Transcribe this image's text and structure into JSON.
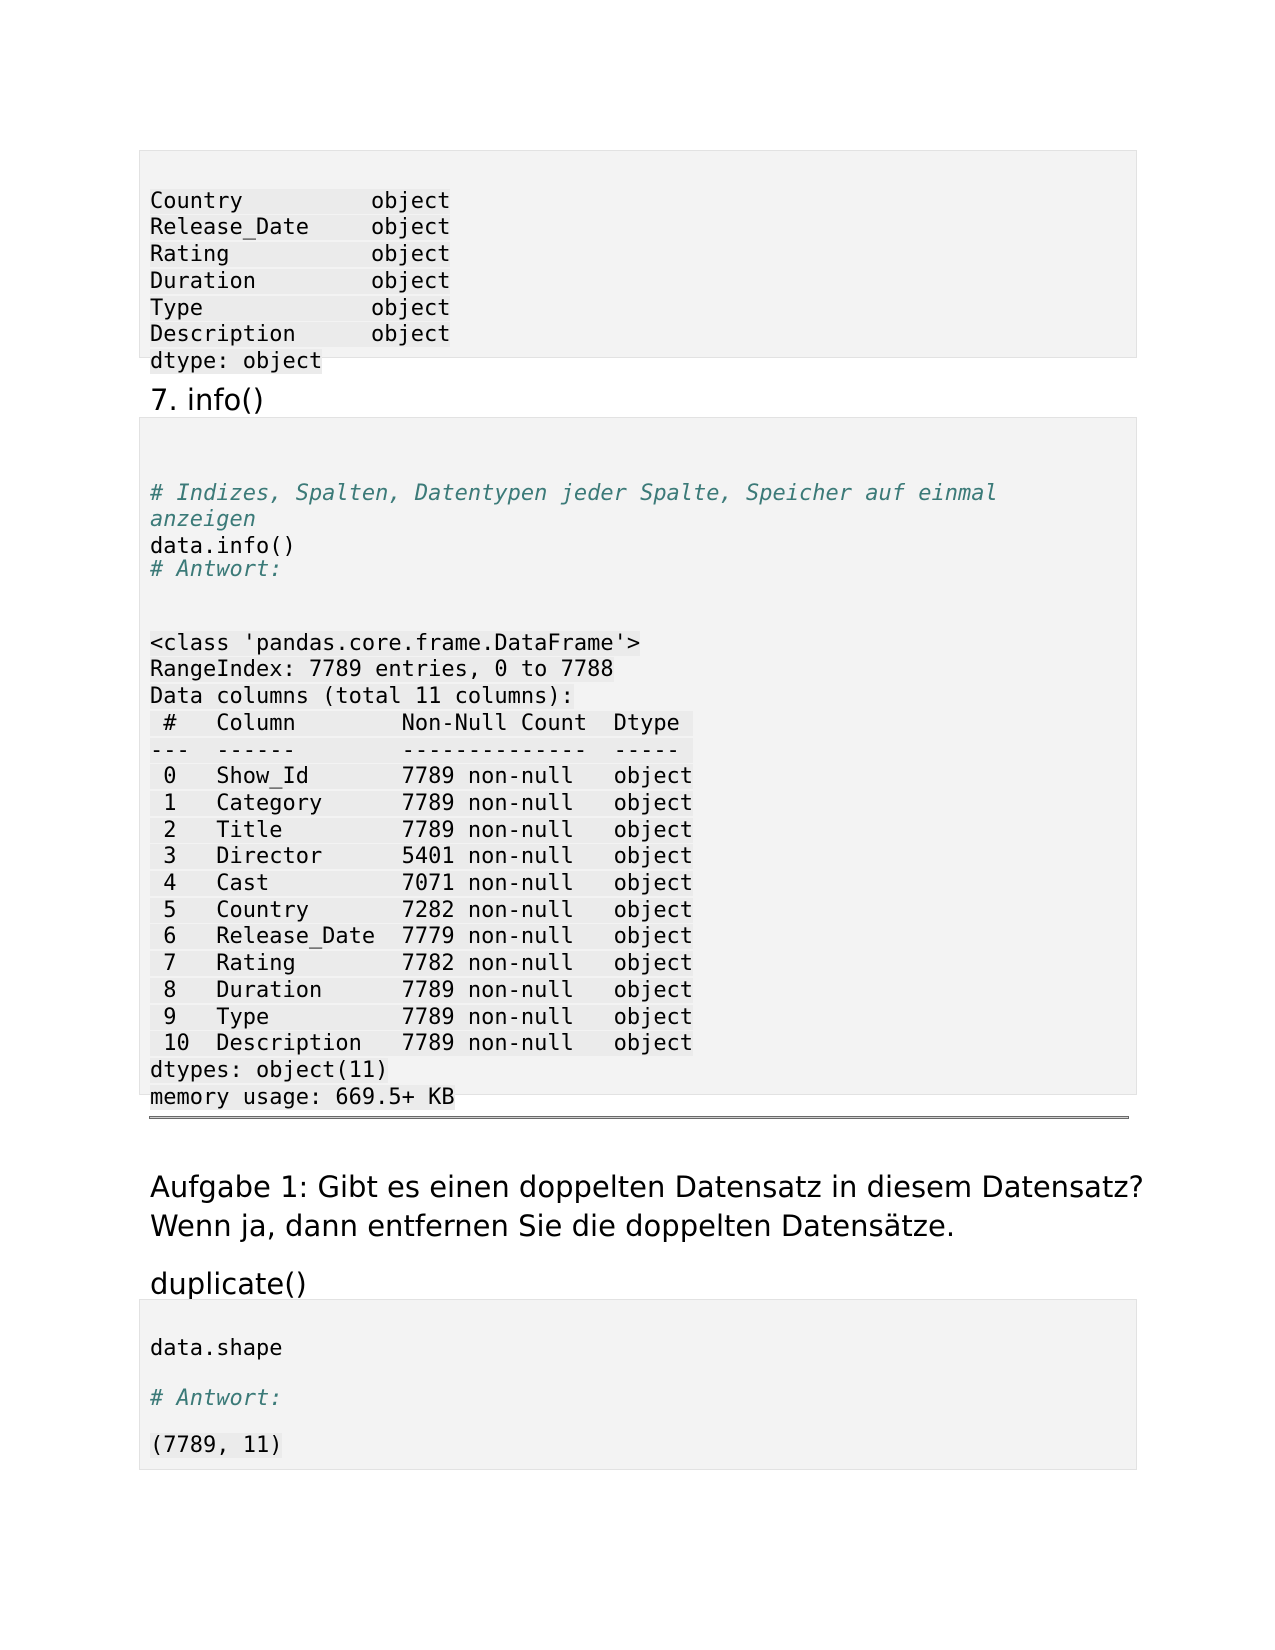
{
  "dtypes_block": {
    "rows": [
      {
        "name": "Country",
        "type": "object"
      },
      {
        "name": "Release_Date",
        "type": "object"
      },
      {
        "name": "Rating",
        "type": "object"
      },
      {
        "name": "Duration",
        "type": "object"
      },
      {
        "name": "Type",
        "type": "object"
      },
      {
        "name": "Description",
        "type": "object"
      }
    ],
    "footer": "dtype: object"
  },
  "info_heading": "7. info()",
  "info_block": {
    "comment_line1": "# Indizes, Spalten, Datentypen jeder Spalte, Speicher auf einmal",
    "comment_line2": "anzeigen",
    "code": "data.info()",
    "answer_comment": "# Antwort:",
    "output_lines": [
      "<class 'pandas.core.frame.DataFrame'>",
      "RangeIndex: 7789 entries, 0 to 7788",
      "Data columns (total 11 columns):",
      " #   Column        Non-Null Count  Dtype ",
      "---  ------        --------------  ----- ",
      " 0   Show_Id       7789 non-null   object",
      " 1   Category      7789 non-null   object",
      " 2   Title         7789 non-null   object",
      " 3   Director      5401 non-null   object",
      " 4   Cast          7071 non-null   object",
      " 5   Country       7282 non-null   object",
      " 6   Release_Date  7779 non-null   object",
      " 7   Rating        7782 non-null   object",
      " 8   Duration      7789 non-null   object",
      " 9   Type          7789 non-null   object",
      " 10  Description   7789 non-null   object",
      "dtypes: object(11)",
      "memory usage: 669.5+ KB"
    ]
  },
  "task_text_line1": "Aufgabe 1: Gibt es einen doppelten Datensatz in diesem Datensatz?",
  "task_text_line2": "Wenn ja, dann entfernen Sie die doppelten Datensätze.",
  "dup_heading": "duplicate()",
  "shape_block": {
    "code": "data.shape",
    "answer_comment": "# Antwort:",
    "output": "(7789, 11)"
  }
}
